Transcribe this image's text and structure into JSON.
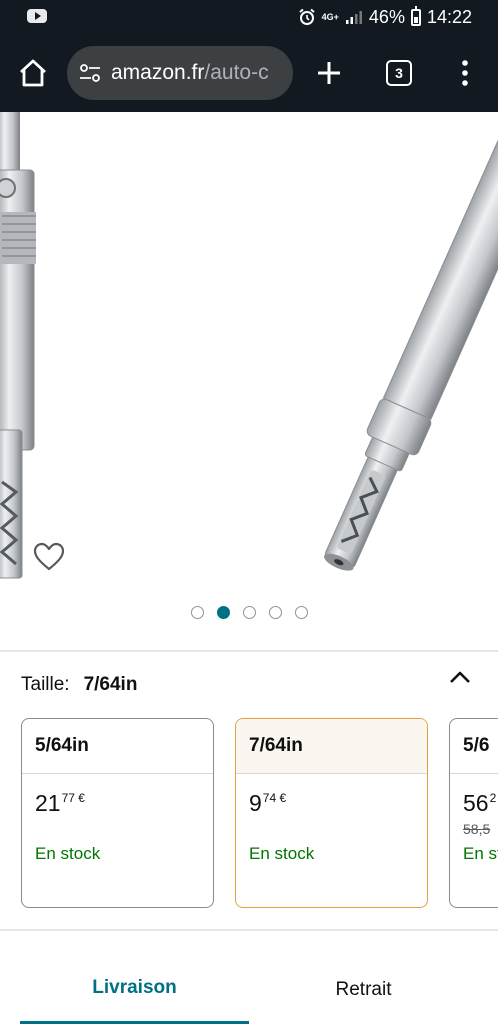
{
  "status_bar": {
    "network": "4G+",
    "battery": "46%",
    "time": "14:22"
  },
  "browser": {
    "url_domain": "amazon.fr",
    "url_path": "/auto-c",
    "tab_count": "3"
  },
  "gallery": {
    "image_count": 5,
    "active_index": 1
  },
  "size": {
    "label": "Taille:",
    "value": "7/64in"
  },
  "size_options": [
    {
      "name": "5/64in",
      "price_whole": "21",
      "price_fraction": "77 €",
      "old_price": "",
      "stock": "En stock",
      "selected": false
    },
    {
      "name": "7/64in",
      "price_whole": "9",
      "price_fraction": "74 €",
      "old_price": "",
      "stock": "En stock",
      "selected": true
    },
    {
      "name": "5/6",
      "price_whole": "56",
      "price_fraction": "2",
      "old_price": "58,5",
      "stock": "En st",
      "selected": false
    }
  ],
  "tabs": {
    "delivery": "Livraison",
    "pickup": "Retrait"
  },
  "colors": {
    "chrome_background": "#131921",
    "accent_teal": "#007185",
    "stock_green": "#007600",
    "selected_border": "#e3a040"
  }
}
